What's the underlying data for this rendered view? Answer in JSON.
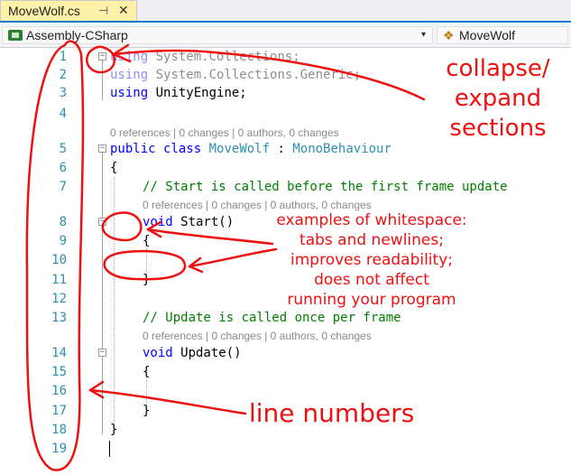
{
  "tab": {
    "title": "MoveWolf.cs",
    "pin_glyph": "⊣",
    "close_glyph": "✕"
  },
  "navbar": {
    "project": "Assembly-CSharp",
    "dropdown_glyph": "▾",
    "class_glyph": "❖",
    "member": "MoveWolf"
  },
  "editor": {
    "line_numbers": [
      "1",
      "2",
      "3",
      "4",
      "5",
      "6",
      "7",
      "8",
      "9",
      "10",
      "11",
      "12",
      "13",
      "14",
      "15",
      "16",
      "17",
      "18",
      "19"
    ],
    "code_lens": {
      "class": "0 references | 0 changes | 0 authors, 0 changes",
      "start": "0 references | 0 changes | 0 authors, 0 changes",
      "update": "0 references | 0 changes | 0 authors, 0 changes"
    },
    "code": {
      "l1_kw": "using",
      "l1_rest": " System.Collections;",
      "l2_kw": "using",
      "l2_rest": " System.Collections.Generic;",
      "l3_kw": "using",
      "l3_rest": " UnityEngine;",
      "l5_kw1": "public",
      "l5_kw2": "class",
      "l5_name": "MoveWolf",
      "l5_colon": " : ",
      "l5_base": "MonoBehaviour",
      "l6": "{",
      "l7": "// Start is called before the first frame update",
      "l8_kw": "void",
      "l8_rest": " Start()",
      "l9": "{",
      "l11": "}",
      "l13": "// Update is called once per frame",
      "l14_kw": "void",
      "l14_rest": " Update()",
      "l15": "{",
      "l17": "}",
      "l18": "}"
    },
    "outline_glyph": "−"
  },
  "annotations": {
    "collapse_line1": "collapse/",
    "collapse_line2": "expand",
    "collapse_line3": "sections",
    "whitespace_lines": [
      "examples of whitespace:",
      "tabs and newlines;",
      "improves readability;",
      "does not affect",
      "running your program"
    ],
    "line_numbers_label": "line numbers",
    "color": "#ee1111"
  }
}
